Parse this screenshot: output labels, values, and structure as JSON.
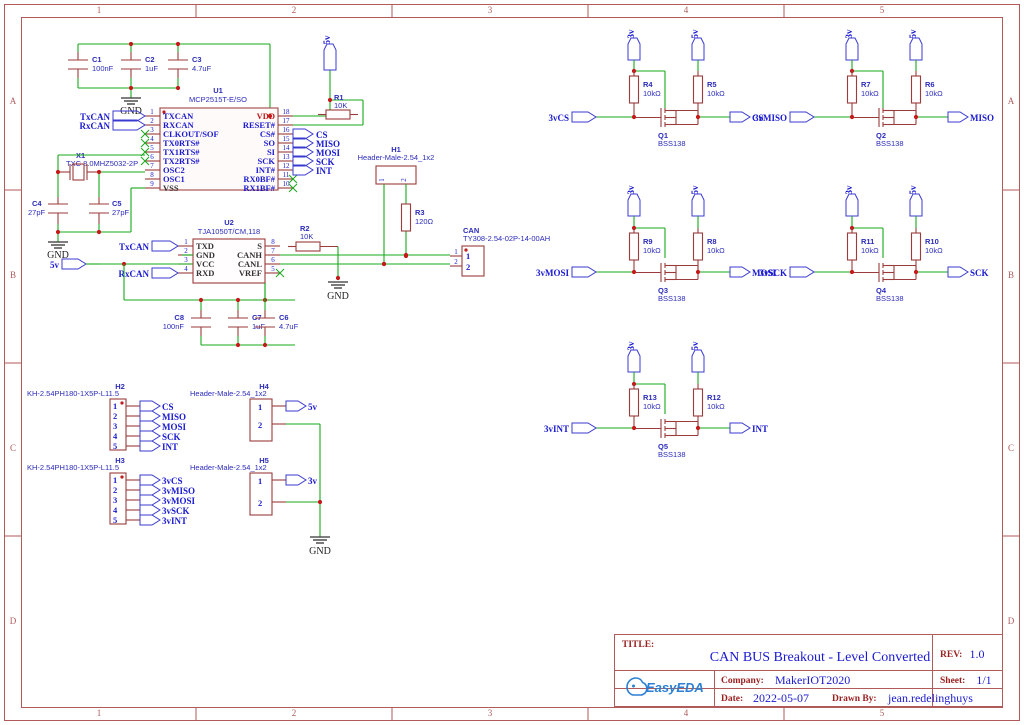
{
  "sheet": {
    "title_label": "TITLE:",
    "title": "CAN BUS Breakout - Level Converted",
    "rev_label": "REV:",
    "rev": "1.0",
    "company_label": "Company:",
    "company": "MakerIOT2020",
    "sheet_label": "Sheet:",
    "sheet_no": "1/1",
    "date_label": "Date:",
    "date": "2022-05-07",
    "drawn_label": "Drawn By:",
    "drawn_by": "jean.redelinghuys",
    "logo": "EasyEDA"
  },
  "frame": {
    "columns": [
      "1",
      "2",
      "3",
      "4",
      "5"
    ],
    "rows": [
      "A",
      "B",
      "C",
      "D"
    ]
  },
  "decoupling_top": [
    {
      "ref": "C1",
      "value": "100nF"
    },
    {
      "ref": "C2",
      "value": "1uF"
    },
    {
      "ref": "C3",
      "value": "4.7uF"
    }
  ],
  "decoupling_bottom": [
    {
      "ref": "C8",
      "value": "100nF"
    },
    {
      "ref": "C7",
      "value": "1uF"
    },
    {
      "ref": "C6",
      "value": "4.7uF"
    }
  ],
  "crystal": {
    "ref": "X1",
    "value": "TXC 8.0MHZ5032-2P",
    "caps": [
      {
        "ref": "C4",
        "value": "27pF"
      },
      {
        "ref": "C5",
        "value": "27pF"
      }
    ]
  },
  "u1": {
    "ref": "U1",
    "value": "MCP2515T-E/SO",
    "left_pins": [
      {
        "num": "1",
        "name": "TXCAN"
      },
      {
        "num": "2",
        "name": "RXCAN"
      },
      {
        "num": "3",
        "name": "CLKOUT/SOF"
      },
      {
        "num": "4",
        "name": "TX0RTS#"
      },
      {
        "num": "5",
        "name": "TX1RTS#"
      },
      {
        "num": "6",
        "name": "TX2RTS#"
      },
      {
        "num": "7",
        "name": "OSC2"
      },
      {
        "num": "8",
        "name": "OSC1"
      },
      {
        "num": "9",
        "name": "VSS"
      }
    ],
    "right_pins": [
      {
        "num": "18",
        "name": "VDD"
      },
      {
        "num": "17",
        "name": "RESET#"
      },
      {
        "num": "16",
        "name": "CS#"
      },
      {
        "num": "15",
        "name": "SO"
      },
      {
        "num": "14",
        "name": "SI"
      },
      {
        "num": "13",
        "name": "SCK"
      },
      {
        "num": "12",
        "name": "INT#"
      },
      {
        "num": "11",
        "name": "RX0BF#"
      },
      {
        "num": "10",
        "name": "RX1BF#"
      }
    ]
  },
  "u2": {
    "ref": "U2",
    "value": "TJA1050T/CM,118",
    "left_pins": [
      {
        "num": "1",
        "name": "TXD"
      },
      {
        "num": "2",
        "name": "GND"
      },
      {
        "num": "3",
        "name": "VCC"
      },
      {
        "num": "4",
        "name": "RXD"
      }
    ],
    "right_pins": [
      {
        "num": "8",
        "name": "S"
      },
      {
        "num": "7",
        "name": "CANH"
      },
      {
        "num": "6",
        "name": "CANL"
      },
      {
        "num": "5",
        "name": "VREF"
      }
    ]
  },
  "resistors": {
    "r1": {
      "ref": "R1",
      "value": "10K"
    },
    "r2": {
      "ref": "R2",
      "value": "10K"
    },
    "r3": {
      "ref": "R3",
      "value": "120Ω"
    }
  },
  "h1": {
    "ref": "H1",
    "value": "Header-Male-2.54_1x2",
    "pins": [
      "1",
      "2"
    ]
  },
  "can_connector": {
    "ref": "CAN",
    "value": "TY308-2.54-02P-14-00AH",
    "pins": [
      "1",
      "2"
    ]
  },
  "h2": {
    "ref": "H2",
    "value": "KH-2.54PH180-1X5P-L11.5",
    "pins": [
      "1",
      "2",
      "3",
      "4",
      "5"
    ],
    "nets": [
      "CS",
      "MISO",
      "MOSI",
      "SCK",
      "INT"
    ]
  },
  "h3": {
    "ref": "H3",
    "value": "KH-2.54PH180-1X5P-L11.5",
    "pins": [
      "1",
      "2",
      "3",
      "4",
      "5"
    ],
    "nets": [
      "3vCS",
      "3vMISO",
      "3vMOSI",
      "3vSCK",
      "3vINT"
    ]
  },
  "h4": {
    "ref": "H4",
    "value": "Header-Male-2.54_1x2",
    "pins": [
      "1",
      "2"
    ],
    "net": "5v"
  },
  "h5": {
    "ref": "H5",
    "value": "Header-Male-2.54_1x2",
    "pins": [
      "1",
      "2"
    ],
    "net": "3v"
  },
  "level_shifters": [
    {
      "id": "ls1",
      "in_net": "3vCS",
      "out_net": "CS",
      "mosfet": {
        "ref": "Q1",
        "value": "BSS138"
      },
      "r_low": {
        "ref": "R4",
        "value": "10kΩ"
      },
      "r_high": {
        "ref": "R5",
        "value": "10kΩ"
      },
      "rail_low": "3v",
      "rail_high": "5v"
    },
    {
      "id": "ls2",
      "in_net": "3vMISO",
      "out_net": "MISO",
      "mosfet": {
        "ref": "Q2",
        "value": "BSS138"
      },
      "r_low": {
        "ref": "R7",
        "value": "10kΩ"
      },
      "r_high": {
        "ref": "R6",
        "value": "10kΩ"
      },
      "rail_low": "3v",
      "rail_high": "5v"
    },
    {
      "id": "ls3",
      "in_net": "3vMOSI",
      "out_net": "MOSI",
      "mosfet": {
        "ref": "Q3",
        "value": "BSS138"
      },
      "r_low": {
        "ref": "R9",
        "value": "10kΩ"
      },
      "r_high": {
        "ref": "R8",
        "value": "10kΩ"
      },
      "rail_low": "3v",
      "rail_high": "5v"
    },
    {
      "id": "ls4",
      "in_net": "3vSCK",
      "out_net": "SCK",
      "mosfet": {
        "ref": "Q4",
        "value": "BSS138"
      },
      "r_low": {
        "ref": "R11",
        "value": "10kΩ"
      },
      "r_high": {
        "ref": "R10",
        "value": "10kΩ"
      },
      "rail_low": "3v",
      "rail_high": "5v"
    },
    {
      "id": "ls5",
      "in_net": "3vINT",
      "out_net": "INT",
      "mosfet": {
        "ref": "Q5",
        "value": "BSS138"
      },
      "r_low": {
        "ref": "R13",
        "value": "10kΩ"
      },
      "r_high": {
        "ref": "R12",
        "value": "10kΩ"
      },
      "rail_low": "3v",
      "rail_high": "5v"
    }
  ],
  "nets": {
    "txcan": "TxCAN",
    "rxcan": "RxCAN",
    "v5": "5v",
    "v3": "3v",
    "gnd": "GND"
  }
}
